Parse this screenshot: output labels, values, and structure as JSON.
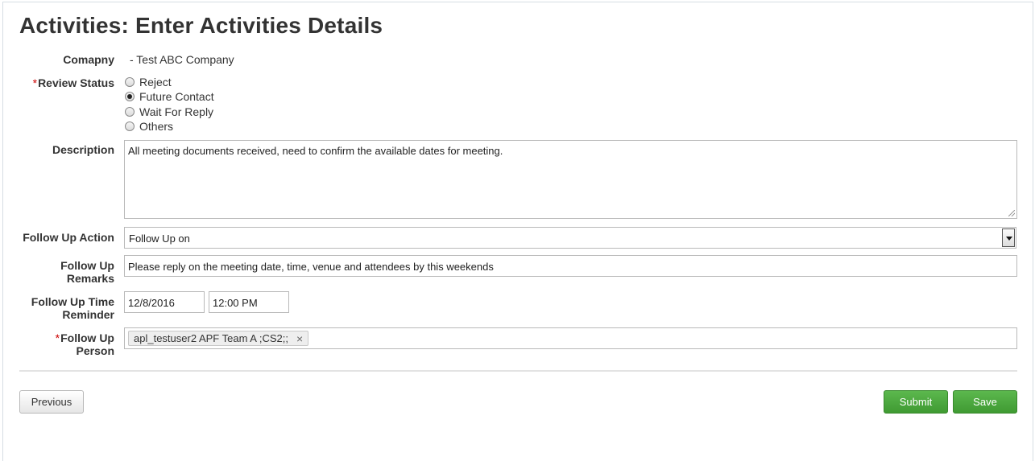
{
  "page": {
    "title": "Activities: Enter Activities Details"
  },
  "form": {
    "company": {
      "label": "Comapny",
      "value": "- Test ABC Company"
    },
    "review_status": {
      "required_mark": "*",
      "label": "Review Status",
      "options": [
        "Reject",
        "Future Contact",
        "Wait For Reply",
        "Others"
      ],
      "selected": "Future Contact"
    },
    "description": {
      "label": "Description",
      "value": "All meeting documents received, need to confirm the available dates for meeting."
    },
    "follow_up_action": {
      "label": "Follow Up Action",
      "value": "Follow Up on"
    },
    "follow_up_remarks": {
      "label_line1": "Follow Up",
      "label_line2": "Remarks",
      "value": "Please reply on the meeting date, time, venue and attendees by this weekends"
    },
    "follow_up_time_reminder": {
      "label_line1": "Follow Up Time",
      "label_line2": "Reminder",
      "date": "12/8/2016",
      "time": "12:00 PM"
    },
    "follow_up_person": {
      "required_mark": "*",
      "label_line1": "Follow Up",
      "label_line2": "Person",
      "tags": [
        "apl_testuser2 APF Team A ;CS2;;"
      ],
      "remove_symbol": "×"
    }
  },
  "buttons": {
    "previous": "Previous",
    "submit": "Submit",
    "save": "Save"
  },
  "colors": {
    "required": "#cc0000",
    "primary_button": "#4cae3f"
  }
}
